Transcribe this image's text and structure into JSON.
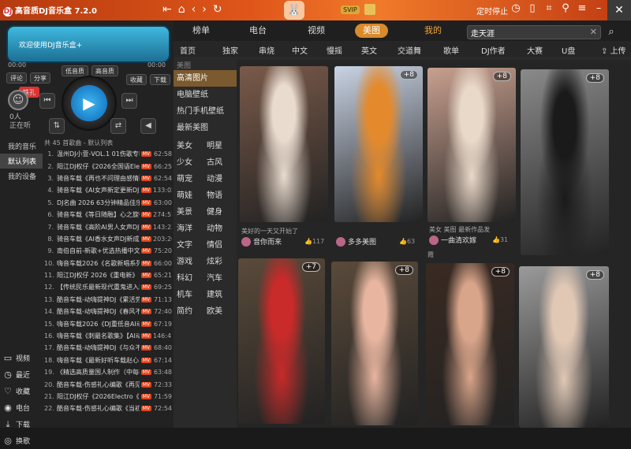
{
  "app": {
    "title": "高音质DJ音乐盒 7.2.0",
    "logo": "DJ"
  },
  "titlebar": {
    "svip": "SVIP",
    "timer_label": "定时停止"
  },
  "player": {
    "lcd_text": "欢迎使用DJ音乐盒+",
    "time_elapsed": "00:00",
    "time_total": "00:00",
    "buttons": {
      "comment": "评论",
      "share": "分享",
      "low_quality": "低音质",
      "high_quality": "高音质",
      "favorite": "收藏",
      "download": "下载",
      "vip": "铁孔"
    },
    "listen_count": "0人",
    "listening": "正在听"
  },
  "playlist": {
    "header": "共 45 首歌曲 - 默认列表",
    "mylist": [
      "我的音乐",
      "默认列表",
      "我的设备"
    ],
    "songs": [
      {
        "n": "1.",
        "title": "温州DJ小萱-VOL.1 01伤歌专辑",
        "dur": "62:58"
      },
      {
        "n": "2.",
        "title": "阳江DJ权仔《2026全国语Electro》",
        "dur": "66:25"
      },
      {
        "n": "3.",
        "title": "骑音车载《再也不问理由感情歌》",
        "dur": "62:54"
      },
      {
        "n": "4.",
        "title": "骑音车载《AI女声新定更新DJ》",
        "dur": "133:02"
      },
      {
        "n": "5.",
        "title": "DJ名曲 2026 63分钟精品佳乐曲",
        "dur": "63:00"
      },
      {
        "n": "6.",
        "title": "骑音车载《等日随融】心之旋律》",
        "dur": "274:57"
      },
      {
        "n": "7.",
        "title": "骑音车载《高阶AI男人女声DJ新》",
        "dur": "143:23"
      },
      {
        "n": "8.",
        "title": "骑音车载《AI香水女声DJ新成》",
        "dur": "203:26"
      },
      {
        "n": "9.",
        "title": "南伯自前-新歌+优选热播中文舞",
        "dur": "75:20"
      },
      {
        "n": "10.",
        "title": "嗨音车载2026《名歌新唱系列》",
        "dur": "66:00"
      },
      {
        "n": "11.",
        "title": "阳江DJ权仔 2026《重电新》",
        "dur": "65:21"
      },
      {
        "n": "12.",
        "title": "【传统民乐最新现代重鬼进入舞曲",
        "dur": "69:25"
      },
      {
        "n": "13.",
        "title": "酷音车载-动嗨提神DJ《累活劳》",
        "dur": "71:13"
      },
      {
        "n": "14.",
        "title": "酷音车载-动嗨提神DJ《春风不》",
        "dur": "72:40"
      },
      {
        "n": "15.",
        "title": "嗨音车载2026《DJ重低音AI动嗨》",
        "dur": "67:19"
      },
      {
        "n": "16.",
        "title": "嗨音车载《刺最名歌集》【AI动》",
        "dur": "146:41"
      },
      {
        "n": "17.",
        "title": "酷音车载-动嗨提神DJ《与众不》",
        "dur": "68:40"
      },
      {
        "n": "18.",
        "title": "嗨音车载《最新好听车载赵心系列》",
        "dur": "67:14"
      },
      {
        "n": "19.",
        "title": "《精选高质量国人制作（中每荟》",
        "dur": "63:48"
      },
      {
        "n": "20.",
        "title": "酷音车载-伤感礼心编歌《再见》",
        "dur": "72:33"
      },
      {
        "n": "21.",
        "title": "阳江DJ权仔《2026Electro《中》》",
        "dur": "71:59"
      },
      {
        "n": "22.",
        "title": "酷音车载-伤感礼心编歌《当初》",
        "dur": "72:54"
      }
    ]
  },
  "sidenav": [
    {
      "icon": "video-icon",
      "glyph": "▭",
      "label": "视频"
    },
    {
      "icon": "recent-icon",
      "glyph": "◷",
      "label": "最近"
    },
    {
      "icon": "heart-icon",
      "glyph": "♡",
      "label": "收藏"
    },
    {
      "icon": "radio-icon",
      "glyph": "◉",
      "label": "电台"
    },
    {
      "icon": "download-icon",
      "glyph": "⤓",
      "label": "下载"
    },
    {
      "icon": "free-icon",
      "glyph": "◎",
      "label": "换歌"
    }
  ],
  "topnav": {
    "tabs": [
      "榜单",
      "电台",
      "视频",
      "美图",
      "我的"
    ],
    "active": "美图"
  },
  "search": {
    "value": "走天涯"
  },
  "subnav": {
    "items": [
      "首页",
      "独家",
      "串烧",
      "中文",
      "慢摇",
      "英文",
      "交道舞",
      "歌单",
      "DJ作者",
      "大赛",
      "U盘"
    ],
    "upload": "上传"
  },
  "categories": {
    "header": "美图",
    "items": [
      "高清图片",
      "电脑壁纸",
      "热门手机壁纸",
      "最新美图"
    ],
    "active": "高清图片",
    "tags": [
      "美女",
      "明星",
      "少女",
      "古风",
      "萌宠",
      "动漫",
      "萌娃",
      "物语",
      "美景",
      "健身",
      "海洋",
      "动物",
      "文字",
      "情侣",
      "游戏",
      "炫彩",
      "科幻",
      "汽车",
      "机车",
      "建筑",
      "简约",
      "欧美"
    ]
  },
  "cards": [
    {
      "badge": "",
      "caption": "美好的一天又开始了",
      "author": "音你而来",
      "likes": "117",
      "palette": [
        "#7a5a4a",
        "#e9dccf"
      ]
    },
    {
      "badge": "+8",
      "caption": "",
      "author": "多多美图",
      "likes": "63",
      "palette": [
        "#c9d3e4",
        "#e58a2c"
      ]
    },
    {
      "badge": "+8",
      "caption": "美女 美图 最新作品发",
      "author": "一曲清欢嫁",
      "likes": "31",
      "palette": [
        "#c8a08f",
        "#e9d9c9"
      ]
    },
    {
      "badge": "+8",
      "caption": "",
      "author": "",
      "likes": "",
      "palette": [
        "#8a8a8a",
        "#1a1a1a"
      ]
    },
    {
      "badge": "+7",
      "caption": "",
      "author": "",
      "likes": "",
      "palette": [
        "#5a4a3a",
        "#c92a2a"
      ]
    },
    {
      "badge": "+8",
      "caption": "",
      "author": "",
      "likes": "",
      "palette": [
        "#5a4a3a",
        "#e8b6a0"
      ]
    },
    {
      "badge": "+8",
      "caption": "",
      "author": "",
      "likes": "",
      "palette": [
        "#3a2a22",
        "#d9a58a"
      ]
    },
    {
      "badge": "+8",
      "caption": "",
      "author": "",
      "likes": "",
      "palette": [
        "#9a9a9a",
        "#e0c8b5"
      ]
    }
  ],
  "card_extra_text": "霞"
}
